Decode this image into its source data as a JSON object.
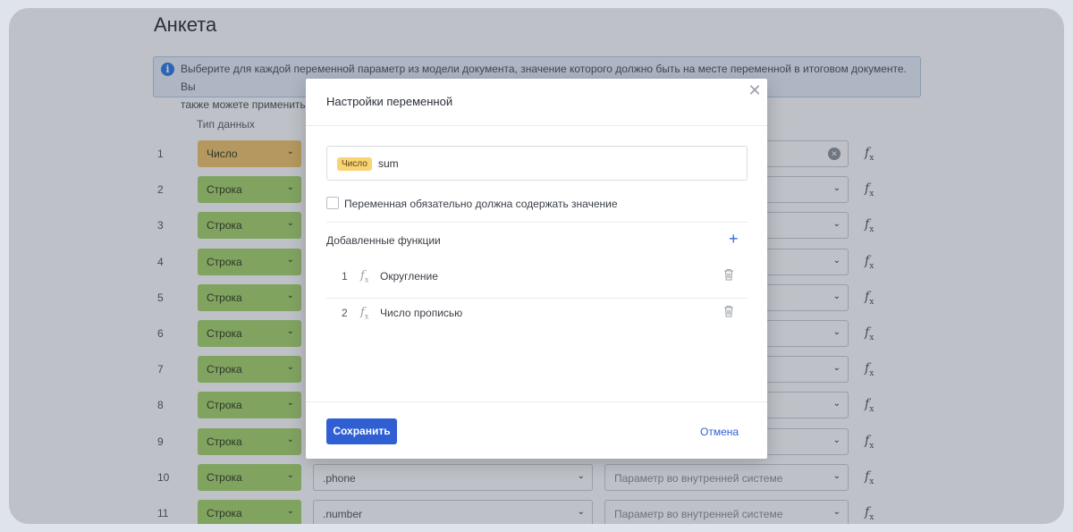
{
  "page": {
    "title": "Анкета",
    "info_line1": "Выберите для каждой переменной параметр из модели документа, значение которого должно быть на месте переменной в итоговом документе. Вы",
    "info_line2": "также можете применить д",
    "col_type_header": "Тип данных"
  },
  "rows": [
    {
      "num": "1",
      "type": "Число",
      "type_color": "#f3c56a"
    },
    {
      "num": "2",
      "type": "Строка",
      "type_color": "#a8d46c"
    },
    {
      "num": "3",
      "type": "Строка",
      "type_color": "#a8d46c"
    },
    {
      "num": "4",
      "type": "Строка",
      "type_color": "#a8d46c"
    },
    {
      "num": "5",
      "type": "Строка",
      "type_color": "#a8d46c"
    },
    {
      "num": "6",
      "type": "Строка",
      "type_color": "#a8d46c"
    },
    {
      "num": "7",
      "type": "Строка",
      "type_color": "#a8d46c"
    },
    {
      "num": "8",
      "type": "Строка",
      "type_color": "#a8d46c"
    },
    {
      "num": "9",
      "type": "Строка",
      "type_color": "#a8d46c"
    },
    {
      "num": "10",
      "type": "Строка",
      "type_color": "#a8d46c",
      "field": ".phone",
      "param_placeholder": "Параметр во внутренней системе"
    },
    {
      "num": "11",
      "type": "Строка",
      "type_color": "#a8d46c",
      "field": ".number",
      "param_placeholder": "Параметр во внутренней системе"
    }
  ],
  "modal": {
    "title": "Настройки переменной",
    "badge": "Число",
    "var_name": "sum",
    "required_label": "Переменная обязательно должна содержать значение",
    "functions_title": "Добавленные функции",
    "functions": [
      {
        "num": "1",
        "label": "Округление"
      },
      {
        "num": "2",
        "label": "Число прописью"
      }
    ],
    "save_label": "Сохранить",
    "cancel_label": "Отмена"
  },
  "colors": {
    "accent": "#2f5fd3",
    "number_badge": "#f9d475",
    "string_type": "#a8d46c",
    "number_type": "#f3c56a"
  },
  "icons": [
    "info-icon",
    "chevron-down-icon",
    "clear-icon",
    "function-icon",
    "close-icon",
    "plus-icon",
    "trash-icon"
  ]
}
